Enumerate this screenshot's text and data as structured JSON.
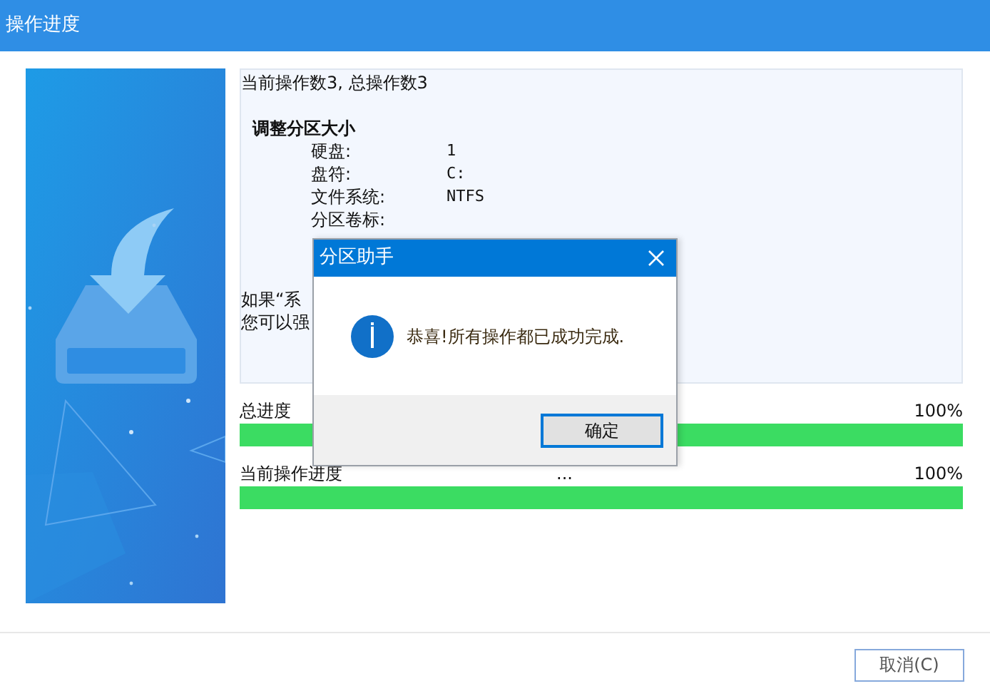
{
  "window": {
    "title": "操作进度"
  },
  "info": {
    "summary": "当前操作数3, 总操作数3",
    "operation": "调整分区大小",
    "details": [
      {
        "label": "硬盘:",
        "value": "1"
      },
      {
        "label": "盘符:",
        "value": "C:"
      },
      {
        "label": "文件系统:",
        "value": "NTFS"
      },
      {
        "label": "分区卷标:"
      }
    ],
    "notes": [
      "如果“系",
      "您可以强"
    ]
  },
  "progress": [
    {
      "label": "总进度",
      "reading": "100%",
      "level": 1
    },
    {
      "label": "当前操作进度",
      "status": "...",
      "reading": "100%",
      "level": 1
    }
  ],
  "cancel_button": "取消(C)",
  "dialog": {
    "title": "分区助手",
    "message": "恭喜!所有操作都已成功完成.",
    "ok_button": "确定"
  }
}
